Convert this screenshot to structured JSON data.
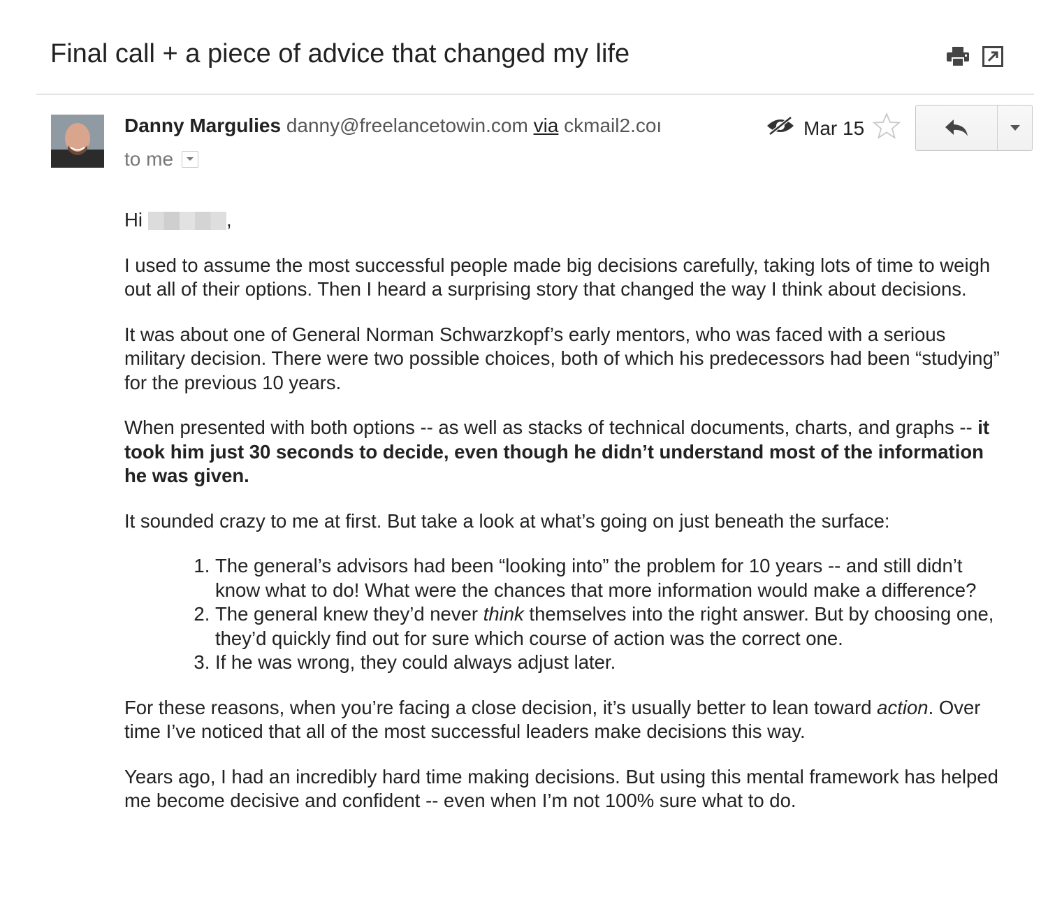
{
  "email": {
    "subject": "Final call + a piece of advice that changed my life",
    "sender": {
      "name": "Danny Margulies",
      "email": "danny@freelancetowin.com",
      "via_label": "via",
      "via_domain": "ckmail2.coı"
    },
    "recipient_label": "to me",
    "date": "Mar 15",
    "icons": [
      "print-icon",
      "new-window-icon",
      "avatar",
      "unread-eye-icon",
      "star-icon",
      "reply-icon",
      "chevron-down-icon"
    ],
    "body": {
      "greeting": "Hi",
      "greeting_comma": ",",
      "p1": "I used to assume the most successful people made big decisions carefully, taking lots of time to weigh out all of their options. Then I heard a surprising story that changed the way I think about decisions.",
      "p2": "It was about one of General Norman Schwarzkopf’s early mentors, who was faced with a serious military decision. There were two possible choices, both of which his predecessors had been “studying” for the previous 10 years.",
      "p3_start": "When presented with both options -- as well as stacks of technical documents, charts, and graphs -- ",
      "p3_bold": "it took him just 30 seconds to decide, even though he didn’t understand most of the information he was given.",
      "p4": "It sounded crazy to me at first. But take a look at what’s going on just beneath the surface:",
      "list": [
        {
          "text": "The general’s advisors had been “looking into” the problem for 10 years -- and still didn’t know what to do! What were the chances that more information would make a difference?"
        },
        {
          "pre": "The general knew they’d never ",
          "em": "think",
          "post": " themselves into the right answer. But by choosing one, they’d quickly find out for sure which course of action was the correct one."
        },
        {
          "text": "If he was wrong, they could always adjust later."
        }
      ],
      "p5_start": "For these reasons, when you’re facing a close decision, it’s usually better to lean toward ",
      "p5_em": "action",
      "p5_end": ". Over time I’ve noticed that all of the most successful leaders make decisions this way.",
      "p6": "Years ago, I had an incredibly hard time making decisions. But using this mental framework has helped me become decisive and confident -- even when I’m not 100% sure what to do."
    }
  }
}
